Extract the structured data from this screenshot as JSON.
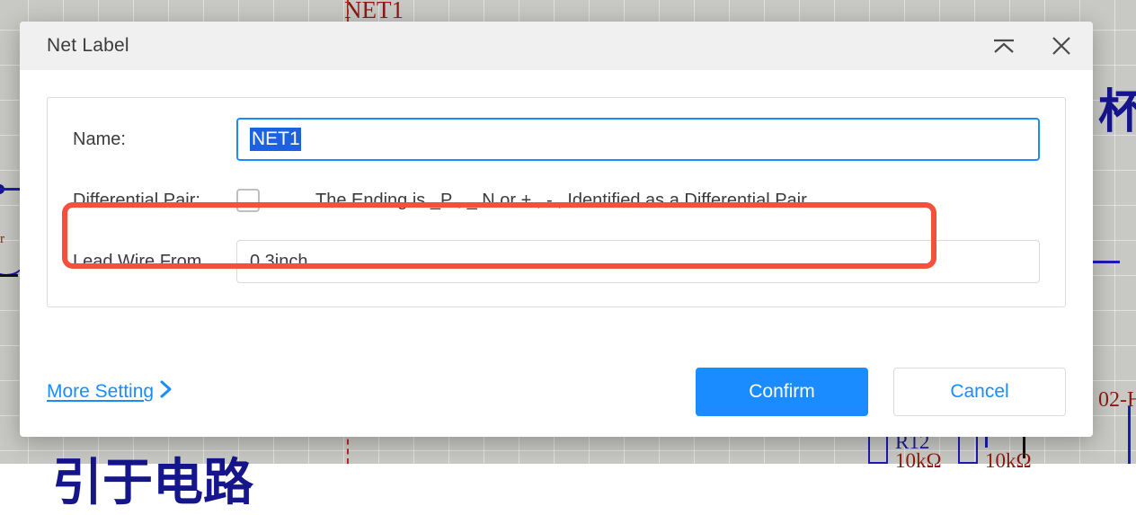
{
  "background": {
    "net_label_top": "NET1",
    "cjk_right": "杯",
    "cjk_bottom": "引于电路",
    "designator_r12": "R12",
    "value_r12": "10kΩ",
    "value_r13": "10kΩ",
    "part_text_right": "02-H"
  },
  "dialog": {
    "title": "Net Label",
    "header": {
      "collapse_icon": "collapse-icon",
      "close_icon": "close-icon"
    },
    "form": {
      "name": {
        "label": "Name:",
        "value": "NET1",
        "placeholder": ""
      },
      "differential_pair": {
        "label": "Differential Pair:",
        "checked": false,
        "hint": "The Ending is _P , _ N or + , - , Identified as a Differential Pair"
      },
      "lead_wire_from": {
        "label": "Lead Wire From",
        "value": "0.3inch",
        "placeholder": ""
      }
    },
    "footer": {
      "more_setting_label": "More Setting",
      "more_setting_icon": "chevron-right-icon",
      "confirm_label": "Confirm",
      "cancel_label": "Cancel"
    }
  },
  "colors": {
    "accent": "#1a8cff",
    "highlight_rect": "#f4503c",
    "selection": "#1d61e0",
    "header_bg": "#f0f0f0",
    "schematic_wire": "#1b1bb4",
    "schematic_text": "#8c1a10"
  }
}
